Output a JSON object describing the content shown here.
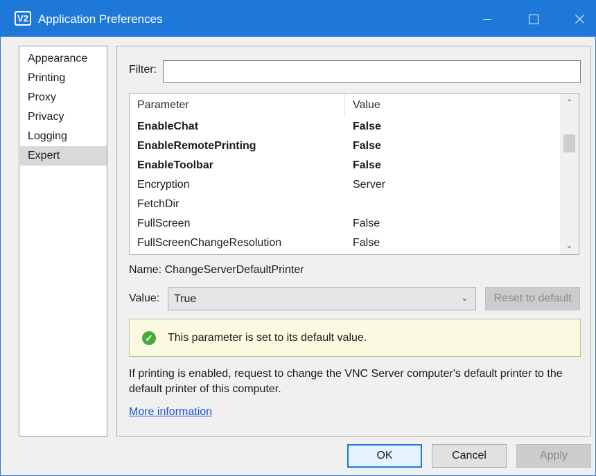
{
  "window": {
    "app_icon": "V2",
    "title": "Application Preferences",
    "accent_color": "#1e78d7"
  },
  "sidebar": {
    "items": [
      {
        "label": "Appearance",
        "selected": false
      },
      {
        "label": "Printing",
        "selected": false
      },
      {
        "label": "Proxy",
        "selected": false
      },
      {
        "label": "Privacy",
        "selected": false
      },
      {
        "label": "Logging",
        "selected": false
      },
      {
        "label": "Expert",
        "selected": true
      }
    ]
  },
  "filter": {
    "label": "Filter:",
    "value": ""
  },
  "table": {
    "columns": [
      "Parameter",
      "Value"
    ],
    "rows": [
      {
        "parameter": "EnableChat",
        "value": "False",
        "bold": true
      },
      {
        "parameter": "EnableRemotePrinting",
        "value": "False",
        "bold": true
      },
      {
        "parameter": "EnableToolbar",
        "value": "False",
        "bold": true
      },
      {
        "parameter": "Encryption",
        "value": "Server",
        "bold": false
      },
      {
        "parameter": "FetchDir",
        "value": "",
        "bold": false
      },
      {
        "parameter": "FullScreen",
        "value": "False",
        "bold": false
      },
      {
        "parameter": "FullScreenChangeResolution",
        "value": "False",
        "bold": false
      }
    ]
  },
  "details": {
    "name_text": "Name:  ChangeServerDefaultPrinter",
    "value_label": "Value:",
    "value_selected": "True",
    "reset_label": "Reset to default",
    "info_text": "This parameter is set to its default value.",
    "info_color": "#4aaa3c",
    "description": "If printing is enabled, request to change the VNC Server computer's default printer to the default printer of this computer.",
    "more_info": "More information"
  },
  "buttons": {
    "ok": "OK",
    "cancel": "Cancel",
    "apply": "Apply"
  }
}
